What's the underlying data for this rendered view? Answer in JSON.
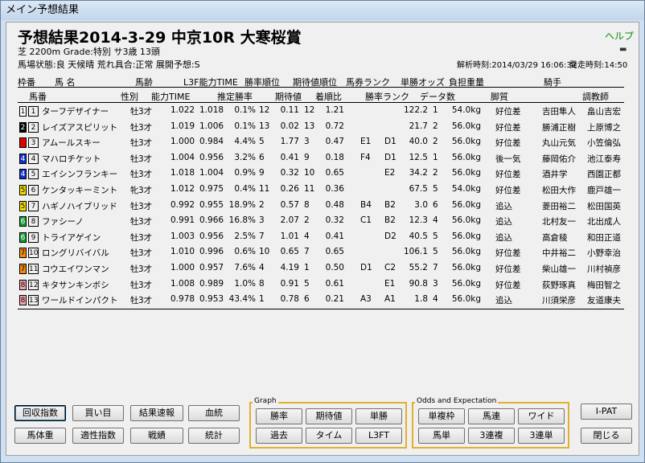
{
  "window": {
    "title": "メイン予想結果"
  },
  "race": {
    "title": "予想結果2014-3-29 中京10R 大寒桜賞",
    "help": "ヘルプ",
    "info1": "芝 2200m  Grade:特別  サ3歳  13頭",
    "info2": "馬場状態:良  天候晴  荒れ具合:正常  展開予想:S",
    "analysis_time": "解析時刻:2014/03/29 16:06:32",
    "post_time": "発走時刻:14:50"
  },
  "headers": {
    "row1": [
      "枠番",
      "馬 名",
      "馬齢",
      "L3F能力TIME",
      "勝率順位",
      "期待値順位",
      "馬券ランク",
      "単勝オッズ",
      "負担重量",
      "騎手"
    ],
    "row2": [
      "馬番",
      "性別",
      "能力TIME",
      "推定勝率",
      "期待値",
      "着順比",
      "勝率ランク",
      "データ数",
      "脚質",
      "調教師"
    ]
  },
  "horses": [
    {
      "waku": "1",
      "waku_color": "#ffffff",
      "waku_text": "#000",
      "num": "1",
      "name": "ターフデザイナー",
      "sex": "牡",
      "age": "3才",
      "time": "1.022",
      "l3f": "1.018",
      "rate": "0.1%",
      "rate_rank": "12",
      "ev": "0.11",
      "ev_rank": "12",
      "ratio": "1.21",
      "b_rank": "",
      "w_rank": "",
      "odds": "122.2",
      "data": "1",
      "weight": "54.0kg",
      "style": "好位差",
      "jockey": "吉田隼人",
      "trainer": "畠山吉宏"
    },
    {
      "waku": "2",
      "waku_color": "#000000",
      "waku_text": "#fff",
      "num": "2",
      "name": "レイズアスピリット",
      "sex": "牡",
      "age": "3才",
      "time": "1.019",
      "l3f": "1.006",
      "rate": "0.1%",
      "rate_rank": "13",
      "ev": "0.02",
      "ev_rank": "13",
      "ratio": "0.72",
      "b_rank": "",
      "w_rank": "",
      "odds": "21.7",
      "data": "2",
      "weight": "56.0kg",
      "style": "好位差",
      "jockey": "勝浦正樹",
      "trainer": "上原博之"
    },
    {
      "waku": "",
      "waku_color": "#e00000",
      "waku_text": "#fff",
      "num": "3",
      "name": "アムールスキー",
      "sex": "牡",
      "age": "3才",
      "time": "1.000",
      "l3f": "0.984",
      "rate": "4.4%",
      "rate_rank": "5",
      "ev": "1.77",
      "ev_rank": "3",
      "ratio": "0.47",
      "b_rank": "E1",
      "w_rank": "D1",
      "odds": "40.0",
      "data": "2",
      "weight": "56.0kg",
      "style": "好位差",
      "jockey": "丸山元気",
      "trainer": "小笠倫弘"
    },
    {
      "waku": "4",
      "waku_color": "#1030d0",
      "waku_text": "#fff",
      "num": "4",
      "name": "マハロチケット",
      "sex": "牡",
      "age": "3才",
      "time": "1.004",
      "l3f": "0.956",
      "rate": "3.2%",
      "rate_rank": "6",
      "ev": "0.41",
      "ev_rank": "9",
      "ratio": "0.18",
      "b_rank": "F4",
      "w_rank": "D1",
      "odds": "12.5",
      "data": "1",
      "weight": "56.0kg",
      "style": "後一気",
      "jockey": "藤岡佑介",
      "trainer": "池江泰寿"
    },
    {
      "waku": "4",
      "waku_color": "#1030d0",
      "waku_text": "#fff",
      "num": "5",
      "name": "エイシンフランキー",
      "sex": "牡",
      "age": "3才",
      "time": "1.018",
      "l3f": "1.004",
      "rate": "0.9%",
      "rate_rank": "9",
      "ev": "0.32",
      "ev_rank": "10",
      "ratio": "0.65",
      "b_rank": "",
      "w_rank": "E2",
      "odds": "34.2",
      "data": "2",
      "weight": "56.0kg",
      "style": "好位差",
      "jockey": "酒井学",
      "trainer": "西園正都"
    },
    {
      "waku": "5",
      "waku_color": "#f5e000",
      "waku_text": "#000",
      "num": "6",
      "name": "ケンタッキーミント",
      "sex": "牝",
      "age": "3才",
      "time": "1.012",
      "l3f": "0.975",
      "rate": "0.4%",
      "rate_rank": "11",
      "ev": "0.26",
      "ev_rank": "11",
      "ratio": "0.36",
      "b_rank": "",
      "w_rank": "",
      "odds": "67.5",
      "data": "5",
      "weight": "54.0kg",
      "style": "好位差",
      "jockey": "松田大作",
      "trainer": "鹿戸雄一"
    },
    {
      "waku": "5",
      "waku_color": "#f5e000",
      "waku_text": "#000",
      "num": "7",
      "name": "ハギノハイブリッド",
      "sex": "牡",
      "age": "3才",
      "time": "0.992",
      "l3f": "0.955",
      "rate": "18.9%",
      "rate_rank": "2",
      "ev": "0.57",
      "ev_rank": "8",
      "ratio": "0.48",
      "b_rank": "B4",
      "w_rank": "B2",
      "odds": "3.0",
      "data": "6",
      "weight": "56.0kg",
      "style": "追込",
      "jockey": "菱田裕二",
      "trainer": "松田国英"
    },
    {
      "waku": "6",
      "waku_color": "#10a030",
      "waku_text": "#fff",
      "num": "8",
      "name": "ファシーノ",
      "sex": "牡",
      "age": "3才",
      "time": "0.991",
      "l3f": "0.966",
      "rate": "16.8%",
      "rate_rank": "3",
      "ev": "2.07",
      "ev_rank": "2",
      "ratio": "0.32",
      "b_rank": "C1",
      "w_rank": "B2",
      "odds": "12.3",
      "data": "4",
      "weight": "56.0kg",
      "style": "追込",
      "jockey": "北村友一",
      "trainer": "北出成人"
    },
    {
      "waku": "6",
      "waku_color": "#10a030",
      "waku_text": "#fff",
      "num": "9",
      "name": "トライアゲイン",
      "sex": "牡",
      "age": "3才",
      "time": "1.003",
      "l3f": "0.956",
      "rate": "2.5%",
      "rate_rank": "7",
      "ev": "1.01",
      "ev_rank": "4",
      "ratio": "0.41",
      "b_rank": "",
      "w_rank": "D2",
      "odds": "40.5",
      "data": "5",
      "weight": "56.0kg",
      "style": "追込",
      "jockey": "高倉稜",
      "trainer": "和田正道"
    },
    {
      "waku": "7",
      "waku_color": "#f08a10",
      "waku_text": "#000",
      "num": "10",
      "name": "ロングリバイバル",
      "sex": "牡",
      "age": "3才",
      "time": "1.010",
      "l3f": "0.996",
      "rate": "0.6%",
      "rate_rank": "10",
      "ev": "0.65",
      "ev_rank": "7",
      "ratio": "0.65",
      "b_rank": "",
      "w_rank": "",
      "odds": "106.1",
      "data": "5",
      "weight": "56.0kg",
      "style": "好位差",
      "jockey": "中井裕二",
      "trainer": "小野幸治"
    },
    {
      "waku": "7",
      "waku_color": "#f08a10",
      "waku_text": "#000",
      "num": "11",
      "name": "コウエイワンマン",
      "sex": "牡",
      "age": "3才",
      "time": "1.000",
      "l3f": "0.957",
      "rate": "7.6%",
      "rate_rank": "4",
      "ev": "4.19",
      "ev_rank": "1",
      "ratio": "0.50",
      "b_rank": "D1",
      "w_rank": "C2",
      "odds": "55.2",
      "data": "7",
      "weight": "56.0kg",
      "style": "好位差",
      "jockey": "柴山雄一",
      "trainer": "川村禎彦"
    },
    {
      "waku": "8",
      "waku_color": "#f7a5b0",
      "waku_text": "#000",
      "num": "12",
      "name": "キタサンキンボシ",
      "sex": "牡",
      "age": "3才",
      "time": "1.008",
      "l3f": "0.989",
      "rate": "1.0%",
      "rate_rank": "8",
      "ev": "0.91",
      "ev_rank": "5",
      "ratio": "0.61",
      "b_rank": "",
      "w_rank": "E1",
      "odds": "90.8",
      "data": "3",
      "weight": "56.0kg",
      "style": "好位差",
      "jockey": "荻野琢真",
      "trainer": "梅田智之"
    },
    {
      "waku": "8",
      "waku_color": "#f7a5b0",
      "waku_text": "#000",
      "num": "13",
      "name": "ワールドインパクト",
      "sex": "牡",
      "age": "3才",
      "time": "0.978",
      "l3f": "0.953",
      "rate": "43.4%",
      "rate_rank": "1",
      "ev": "0.78",
      "ev_rank": "6",
      "ratio": "0.21",
      "b_rank": "A3",
      "w_rank": "A1",
      "odds": "1.8",
      "data": "4",
      "weight": "56.0kg",
      "style": "追込",
      "jockey": "川須栄彦",
      "trainer": "友道康夫"
    }
  ],
  "buttons": {
    "left": [
      "回収指数",
      "買い目",
      "結果速報",
      "血統",
      "馬体重",
      "適性指数",
      "戦績",
      "統計"
    ],
    "graph_label": "Graph",
    "graph": [
      "勝率",
      "期待値",
      "単勝",
      "過去",
      "タイム",
      "L3FT"
    ],
    "odds_label": "Odds and Expectation",
    "odds": [
      "単複枠",
      "馬連",
      "ワイド",
      "馬単",
      "3連複",
      "3連単"
    ],
    "right": [
      "I-PAT",
      "閉じる"
    ]
  }
}
